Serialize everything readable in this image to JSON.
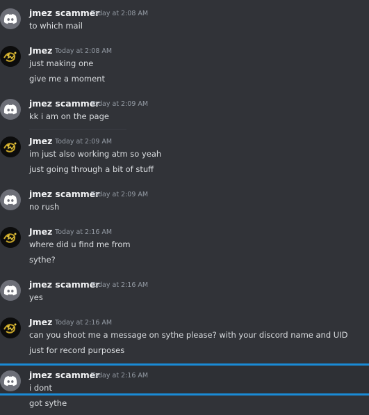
{
  "users": {
    "jmez_scammer": "jmez scammer",
    "jmez": "Jmez"
  },
  "messages": [
    {
      "author": "jmez scammer",
      "time": "Today at 2:08 AM",
      "lines": [
        "to which mail"
      ]
    },
    {
      "author": "Jmez",
      "time": "Today at 2:08 AM",
      "lines": [
        "just making one",
        "give me a moment"
      ]
    },
    {
      "author": "jmez scammer",
      "time": "Today at 2:09 AM",
      "lines": [
        "kk i am on the page"
      ]
    },
    {
      "author": "Jmez",
      "time": "Today at 2:09 AM",
      "lines": [
        "im just also working atm so yeah",
        "just going through a bit of stuff"
      ]
    },
    {
      "author": "jmez scammer",
      "time": "Today at 2:09 AM",
      "lines": [
        "no rush"
      ]
    },
    {
      "author": "Jmez",
      "time": "Today at 2:16 AM",
      "lines": [
        "where did u find me from",
        "sythe?"
      ]
    },
    {
      "author": "jmez scammer",
      "time": "Today at 2:16 AM",
      "lines": [
        "yes"
      ]
    },
    {
      "author": "Jmez",
      "time": "Today at 2:16 AM",
      "lines": [
        "can you shoot me a message on sythe please? with your discord name and UID",
        "just for record purposes"
      ]
    },
    {
      "author": "jmez scammer",
      "time": "Today at 2:16 AM",
      "lines": [
        "i dont",
        "got sythe"
      ]
    }
  ],
  "icons": {
    "discord_avatar": "discord-logo-icon",
    "jmez_avatar": "jmez-logo-icon"
  },
  "colors": {
    "background": "#313338",
    "username": "#f2f3f5",
    "text": "#dbdee1",
    "timestamp": "#949ba4",
    "highlight_line": "#1a8bd6",
    "discord_avatar_bg": "#6d6f78"
  }
}
